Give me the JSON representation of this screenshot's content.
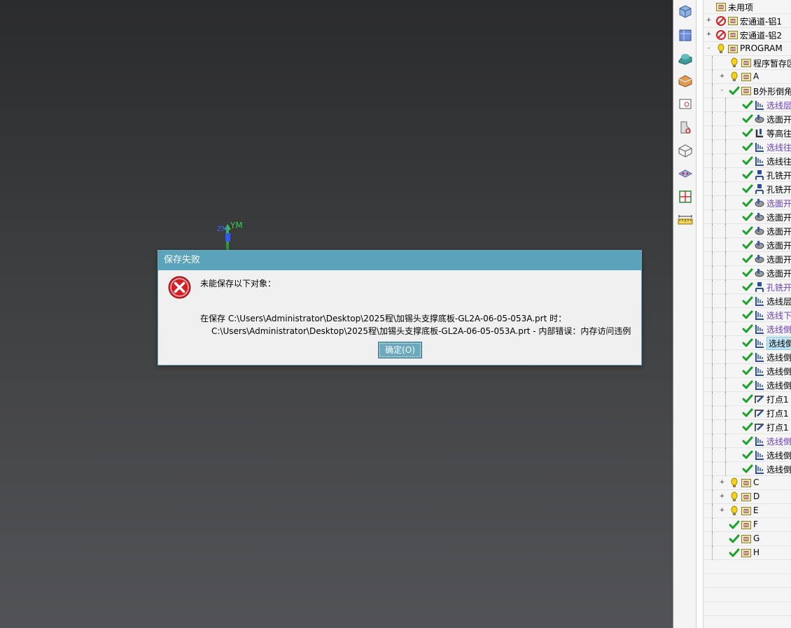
{
  "viewport": {
    "axis_ym": "YM",
    "axis_zm": "ZM"
  },
  "dialog": {
    "title": "保存失败",
    "heading": "未能保存以下对象：",
    "line1": "在保存 C:\\Users\\Administrator\\Desktop\\2025程\\加锡头支撑底板-GL2A-06-05-053A.prt 时：",
    "line2": "C:\\Users\\Administrator\\Desktop\\2025程\\加锡头支撑底板-GL2A-06-05-053A.prt -  内部错误：内存访问违例",
    "ok_label": "确定(O)"
  },
  "toolbar": {
    "tools": [
      "front-view-icon",
      "iso-view-icon",
      "shaded-icon",
      "section-icon",
      "camera-view-icon",
      "display-filter-icon",
      "wireframe-icon",
      "layer-icon",
      "grid-icon",
      "measure-icon"
    ]
  },
  "tree": {
    "rows": [
      {
        "label": "未用项",
        "icon": "folder-icon",
        "status": "none",
        "level": 0,
        "expander": ""
      },
      {
        "label": "宏通道-铝1",
        "icon": "folder-icon",
        "status": "disabled",
        "level": 0,
        "expander": "+"
      },
      {
        "label": "宏通道-铝2",
        "icon": "folder-icon",
        "status": "disabled",
        "level": 0,
        "expander": "+"
      },
      {
        "label": "PROGRAM",
        "icon": "folder-icon",
        "status": "warning",
        "level": 0,
        "expander": "-"
      },
      {
        "label": "程序暂存区",
        "icon": "folder-icon",
        "status": "warning",
        "level": 1,
        "expander": ""
      },
      {
        "label": "A",
        "icon": "folder-icon",
        "status": "warning",
        "level": 1,
        "expander": "+"
      },
      {
        "label": "B外形倒角",
        "icon": "folder-icon",
        "status": "ok",
        "level": 1,
        "expander": "-"
      },
      {
        "label": "选线层",
        "icon": "planar-op-icon",
        "status": "ok",
        "level": 2,
        "purple": true
      },
      {
        "label": "选面开粗",
        "icon": "cavity-mill-icon",
        "status": "ok",
        "level": 2
      },
      {
        "label": "等高往复",
        "icon": "zlevel-icon",
        "status": "ok",
        "level": 2
      },
      {
        "label": "选线往复",
        "icon": "planar-op-icon",
        "status": "ok",
        "level": 2,
        "purple": true
      },
      {
        "label": "选线往复",
        "icon": "planar-op-icon",
        "status": "ok",
        "level": 2
      },
      {
        "label": "孔铣开粗",
        "icon": "hole-mill-icon",
        "status": "ok",
        "level": 2
      },
      {
        "label": "孔铣开粗",
        "icon": "hole-mill-icon",
        "status": "ok",
        "level": 2
      },
      {
        "label": "选面开粗",
        "icon": "cavity-mill-icon",
        "status": "ok",
        "level": 2,
        "purple": true
      },
      {
        "label": "选面开粗",
        "icon": "cavity-mill-icon",
        "status": "ok",
        "level": 2
      },
      {
        "label": "选面开粗",
        "icon": "cavity-mill-icon",
        "status": "ok",
        "level": 2
      },
      {
        "label": "选面开粗",
        "icon": "cavity-mill-icon",
        "status": "ok",
        "level": 2
      },
      {
        "label": "选面开粗",
        "icon": "cavity-mill-icon",
        "status": "ok",
        "level": 2
      },
      {
        "label": "选面开粗",
        "icon": "cavity-mill-icon",
        "status": "ok",
        "level": 2
      },
      {
        "label": "孔铣开粗",
        "icon": "hole-mill-icon",
        "status": "ok",
        "level": 2,
        "purple": true
      },
      {
        "label": "选线层",
        "icon": "planar-op-icon",
        "status": "ok",
        "level": 2
      },
      {
        "label": "选线下刀",
        "icon": "planar-op-icon",
        "status": "ok",
        "level": 2,
        "purple": true
      },
      {
        "label": "选线倒角",
        "icon": "planar-op-icon",
        "status": "ok",
        "level": 2,
        "purple": true
      },
      {
        "label": "选线倒角",
        "icon": "planar-op-icon",
        "status": "ok",
        "level": 2,
        "selected": true
      },
      {
        "label": "选线倒角",
        "icon": "planar-op-icon",
        "status": "ok",
        "level": 2
      },
      {
        "label": "选线倒角",
        "icon": "planar-op-icon",
        "status": "ok",
        "level": 2
      },
      {
        "label": "选线倒角",
        "icon": "planar-op-icon",
        "status": "ok",
        "level": 2
      },
      {
        "label": "打点1",
        "icon": "drill-icon",
        "status": "ok",
        "level": 2
      },
      {
        "label": "打点1",
        "icon": "drill-icon",
        "status": "ok",
        "level": 2
      },
      {
        "label": "打点1",
        "icon": "drill-icon",
        "status": "ok",
        "level": 2
      },
      {
        "label": "选线倒角",
        "icon": "planar-op-icon",
        "status": "ok",
        "level": 2,
        "purple": true
      },
      {
        "label": "选线倒角",
        "icon": "planar-op-icon",
        "status": "ok",
        "level": 2
      },
      {
        "label": "选线倒角",
        "icon": "planar-op-icon",
        "status": "ok",
        "level": 2
      },
      {
        "label": "C",
        "icon": "folder-icon",
        "status": "warning",
        "level": 1,
        "expander": "+"
      },
      {
        "label": "D",
        "icon": "folder-icon",
        "status": "warning",
        "level": 1,
        "expander": "+"
      },
      {
        "label": "E",
        "icon": "folder-icon",
        "status": "warning",
        "level": 1,
        "expander": "+"
      },
      {
        "label": "F",
        "icon": "folder-icon",
        "status": "ok",
        "level": 1,
        "expander": ""
      },
      {
        "label": "G",
        "icon": "folder-icon",
        "status": "ok",
        "level": 1,
        "expander": ""
      },
      {
        "label": "H",
        "icon": "folder-icon",
        "status": "ok",
        "level": 1,
        "expander": ""
      }
    ]
  },
  "colors": {
    "dialog_title_bg": "#5aa3bb",
    "ok_button_bg": "#6aa9c0",
    "purple_text": "#6a3fc3",
    "check_green": "#1aa32a",
    "error_red": "#d41f25"
  }
}
